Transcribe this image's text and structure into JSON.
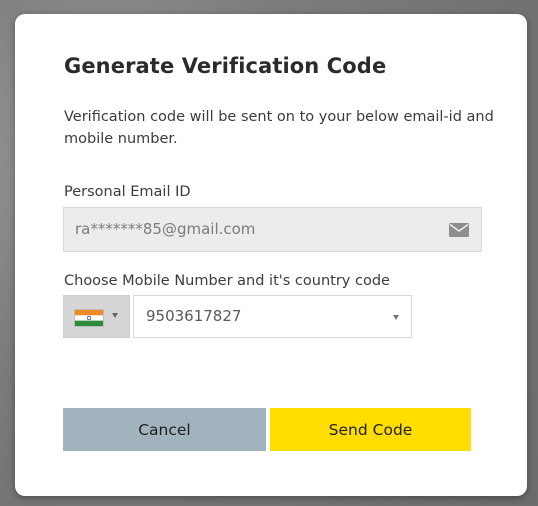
{
  "dialog": {
    "title": "Generate Verification Code",
    "description": "Verification code will be sent on to your below email-id and mobile number."
  },
  "email": {
    "label": "Personal Email ID",
    "value": "ra*******85@gmail.com",
    "icon": "envelope-icon"
  },
  "mobile": {
    "label": "Choose Mobile Number and it's country code",
    "country_flag": "india-flag-icon",
    "selected_number": "9503617827"
  },
  "buttons": {
    "cancel": "Cancel",
    "send": "Send Code"
  },
  "colors": {
    "cancel_bg": "#a3b3bd",
    "send_bg": "#ffdd00",
    "input_disabled_bg": "#ececec"
  }
}
